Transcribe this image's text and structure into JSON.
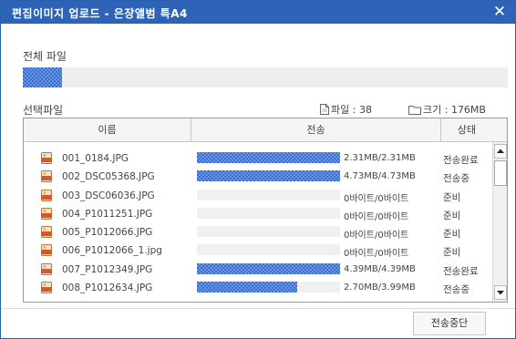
{
  "window": {
    "title": "편집이미지 업로드 - 은장앨범 특A4",
    "close_glyph": "✕"
  },
  "overall": {
    "label": "전체 파일",
    "progress": 0.08
  },
  "selection": {
    "label": "선택파일",
    "files_stat": "파일 : 38",
    "size_stat": "크기 : 176MB"
  },
  "table": {
    "headers": [
      "이름",
      "전송",
      "상태"
    ],
    "rows": [
      {
        "name": "001_0184.JPG",
        "progress": 1.0,
        "size": "2.31MB/2.31MB",
        "status": "전송완료"
      },
      {
        "name": "002_DSC05368.JPG",
        "progress": 1.0,
        "size": "4.73MB/4.73MB",
        "status": "전송중"
      },
      {
        "name": "003_DSC06036.JPG",
        "progress": 0.0,
        "size": "0바이트/0바이트",
        "status": "준비"
      },
      {
        "name": "004_P1011251.JPG",
        "progress": 0.0,
        "size": "0바이트/0바이트",
        "status": "준비"
      },
      {
        "name": "005_P1012066.JPG",
        "progress": 0.0,
        "size": "0바이트/0바이트",
        "status": "준비"
      },
      {
        "name": "006_P1012066_1.jpg",
        "progress": 0.0,
        "size": "0바이트/0바이트",
        "status": "준비"
      },
      {
        "name": "007_P1012349.JPG",
        "progress": 1.0,
        "size": "4.39MB/4.39MB",
        "status": "전송완료"
      },
      {
        "name": "008_P1012634.JPG",
        "progress": 0.7,
        "size": "2.70MB/3.99MB",
        "status": "전송중"
      }
    ]
  },
  "buttons": {
    "stop": "전송중단"
  },
  "icons": {
    "file": "jpg-file-icon",
    "files_stat": "document-icon",
    "size_stat": "folder-icon"
  },
  "colors": {
    "titlebar": "#2e64b8",
    "progress": "#3a6fd0"
  }
}
